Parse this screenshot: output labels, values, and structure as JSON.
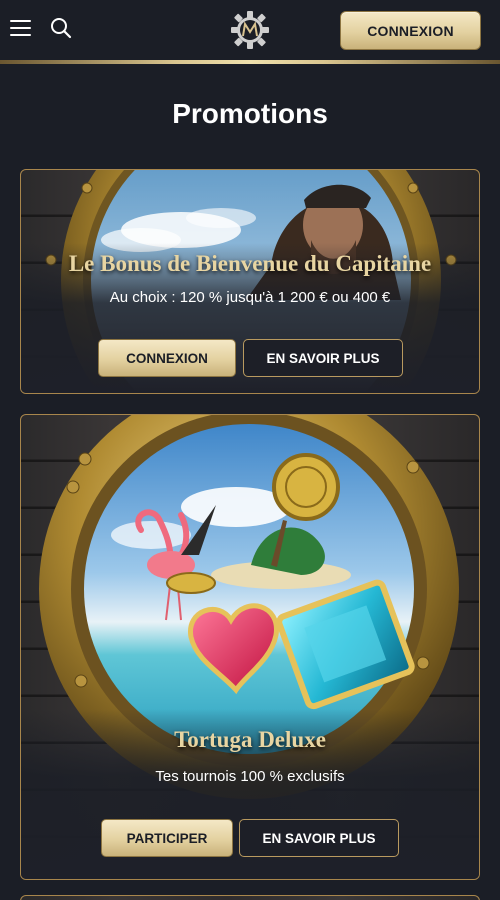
{
  "header": {
    "menu_icon": "hamburger-menu-icon",
    "search_icon": "search-icon",
    "logo_icon": "casino-logo-icon",
    "login_label": "CONNEXION"
  },
  "page": {
    "title": "Promotions"
  },
  "promotions": [
    {
      "title": "Le Bonus de Bienvenue du Capitaine",
      "subtitle": "Au choix : 120 % jusqu'à 1 200 € ou 400 €",
      "primary_label": "CONNEXION",
      "secondary_label": "EN SAVOIR PLUS"
    },
    {
      "title": "Tortuga Deluxe",
      "subtitle": "Tes tournois 100 % exclusifs",
      "primary_label": "PARTICIPER",
      "secondary_label": "EN SAVOIR PLUS"
    }
  ],
  "colors": {
    "background": "#1b1e26",
    "gold_accent": "#e3d1a0",
    "card_title": "#e8d5a2",
    "border_gold": "#a8864c"
  }
}
